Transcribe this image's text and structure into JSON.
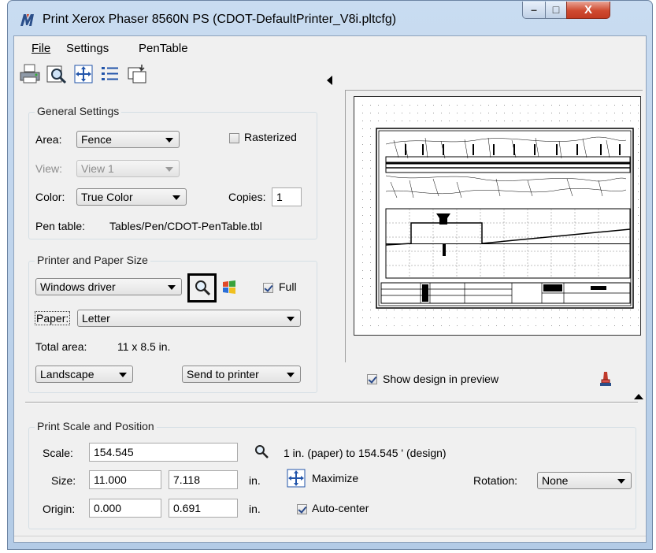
{
  "window": {
    "title": "Print  Xerox Phaser 8560N PS  (CDOT-DefaultPrinter_V8i.pltcfg)",
    "controls": {
      "minimize": "–",
      "maximize": "□",
      "close": "X"
    }
  },
  "menubar": {
    "items": [
      {
        "label": "File"
      },
      {
        "label": "Settings"
      },
      {
        "label": "PenTable"
      }
    ]
  },
  "toolbar": {
    "icons": [
      "printer-icon",
      "preview-magnifier-icon",
      "maximize-icon",
      "list-icon",
      "copy-icon"
    ]
  },
  "general_settings": {
    "legend": "General Settings",
    "area_label": "Area:",
    "area_value": "Fence",
    "rasterized_label": "Rasterized",
    "rasterized_checked": false,
    "view_label": "View:",
    "view_value": "View 1",
    "color_label": "Color:",
    "color_value": "True Color",
    "copies_label": "Copies:",
    "copies_value": "1",
    "pen_table_label": "Pen table:",
    "pen_table_value": "Tables/Pen/CDOT-PenTable.tbl"
  },
  "printer_paper": {
    "legend": "Printer and Paper Size",
    "driver_value": "Windows driver",
    "full_label": "Full",
    "full_checked": true,
    "paper_label": "Paper:",
    "paper_value": "Letter",
    "total_area_label": "Total area:",
    "total_area_value": "11 x 8.5 in.",
    "orientation_value": "Landscape",
    "destination_value": "Send to printer"
  },
  "preview": {
    "show_design_label": "Show design in preview",
    "show_design_checked": true
  },
  "scale_position": {
    "legend": "Print Scale and Position",
    "scale_label": "Scale:",
    "scale_value": "154.545",
    "scale_desc": "1 in. (paper) to 154.545 ' (design)",
    "size_label": "Size:",
    "size_width": "11.000",
    "size_height": "7.118",
    "size_unit": "in.",
    "maximize_label": "Maximize",
    "rotation_label": "Rotation:",
    "rotation_value": "None",
    "origin_label": "Origin:",
    "origin_x": "0.000",
    "origin_y": "0.691",
    "origin_unit": "in.",
    "autocenter_label": "Auto-center",
    "autocenter_checked": true
  },
  "colors": {
    "title_bar": "#c9dcf1",
    "client_bg": "#f0f0f0",
    "close_button": "#cf4a30",
    "highlight_box": "#000000"
  }
}
